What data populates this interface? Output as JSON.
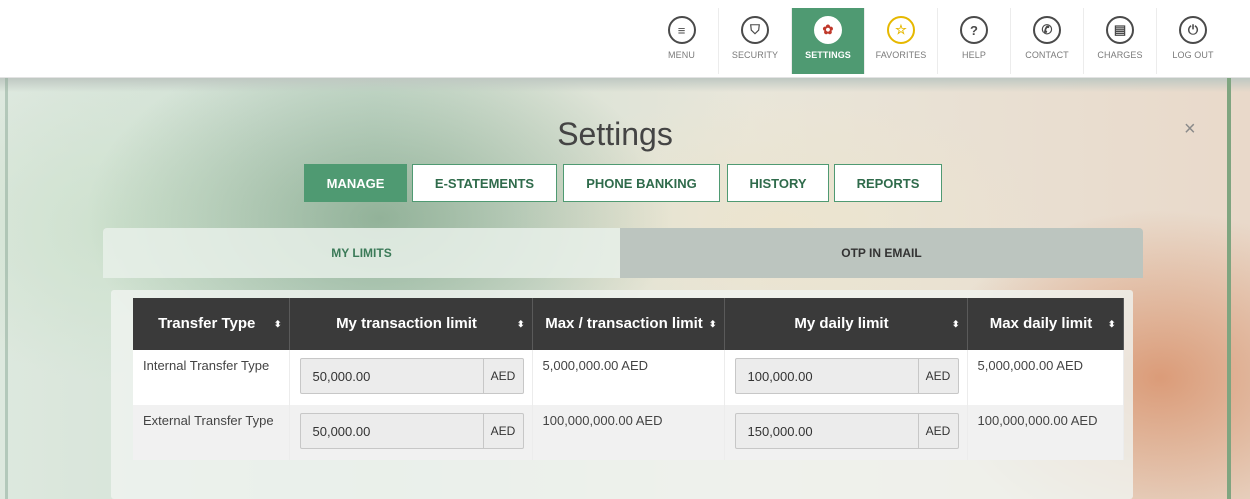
{
  "nav": [
    {
      "label": "MENU",
      "icon": "≡",
      "icon_name": "menu-icon"
    },
    {
      "label": "SECURITY",
      "icon": "⛉",
      "icon_name": "shield-icon"
    },
    {
      "label": "SETTINGS",
      "icon": "✿",
      "icon_name": "gear-icon",
      "active": true
    },
    {
      "label": "FAVORITES",
      "icon": "☆",
      "icon_name": "star-icon"
    },
    {
      "label": "HELP",
      "icon": "?",
      "icon_name": "help-icon"
    },
    {
      "label": "CONTACT",
      "icon": "✆",
      "icon_name": "phone-icon"
    },
    {
      "label": "CHARGES",
      "icon": "▤",
      "icon_name": "charges-icon"
    },
    {
      "label": "LOG OUT",
      "icon": "⏻",
      "icon_name": "power-icon"
    }
  ],
  "page": {
    "title": "Settings",
    "close_symbol": "×"
  },
  "tabs": [
    {
      "label": "MANAGE",
      "active": true
    },
    {
      "label": "E-STATEMENTS"
    },
    {
      "label": "PHONE BANKING"
    },
    {
      "label": "HISTORY"
    },
    {
      "label": "REPORTS"
    }
  ],
  "subtabs": [
    {
      "label": "MY LIMITS",
      "active": true
    },
    {
      "label": "OTP IN EMAIL"
    }
  ],
  "table": {
    "headers": [
      "Transfer Type",
      "My transaction limit",
      "Max / transaction limit",
      "My daily limit",
      "Max daily limit"
    ],
    "sort_symbol": "⬍",
    "rows": [
      {
        "type": "Internal Transfer Type",
        "my_tx": "50,000.00",
        "my_tx_cur": "AED",
        "max_tx": "5,000,000.00 AED",
        "my_daily": "100,000.00",
        "my_daily_cur": "AED",
        "max_daily": "5,000,000.00 AED"
      },
      {
        "type": "External Transfer Type",
        "my_tx": "50,000.00",
        "my_tx_cur": "AED",
        "max_tx": "100,000,000.00 AED",
        "my_daily": "150,000.00",
        "my_daily_cur": "AED",
        "max_daily": "100,000,000.00 AED"
      }
    ]
  },
  "colors": {
    "accent": "#4f9a72",
    "header_dark": "#3a3a3a"
  }
}
